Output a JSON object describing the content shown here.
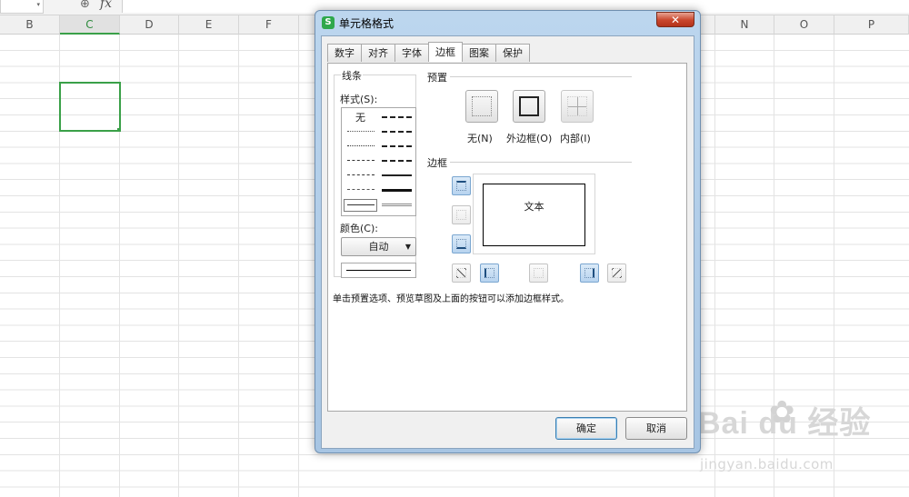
{
  "spreadsheet": {
    "columns": [
      "B",
      "C",
      "D",
      "E",
      "F",
      "N",
      "O",
      "P"
    ],
    "active_column": "C"
  },
  "dialog": {
    "title": "单元格格式",
    "app_icon_letter": "S",
    "close_glyph": "✕",
    "tabs": [
      {
        "label": "数字",
        "active": false
      },
      {
        "label": "对齐",
        "active": false
      },
      {
        "label": "字体",
        "active": false
      },
      {
        "label": "边框",
        "active": true
      },
      {
        "label": "图案",
        "active": false
      },
      {
        "label": "保护",
        "active": false
      }
    ],
    "lines_group": {
      "title": "线条",
      "style_label": "样式(S):",
      "none_label": "无",
      "color_label": "颜色(C):",
      "color_value": "自动"
    },
    "preset_group": {
      "title": "预置",
      "presets": [
        {
          "label": "无(N)"
        },
        {
          "label": "外边框(O)"
        },
        {
          "label": "内部(I)"
        }
      ]
    },
    "border_group": {
      "title": "边框",
      "preview_text": "文本"
    },
    "hint": "单击预置选项、预览草图及上面的按钮可以添加边框样式。",
    "ok_label": "确定",
    "cancel_label": "取消"
  },
  "watermark": {
    "main": "Bai  du 经验",
    "sub": "jingyan.baidu.com"
  },
  "colors": {
    "accent_green": "#3aa048",
    "dialog_frame": "#a7c5e3",
    "close_red": "#c9462c"
  }
}
